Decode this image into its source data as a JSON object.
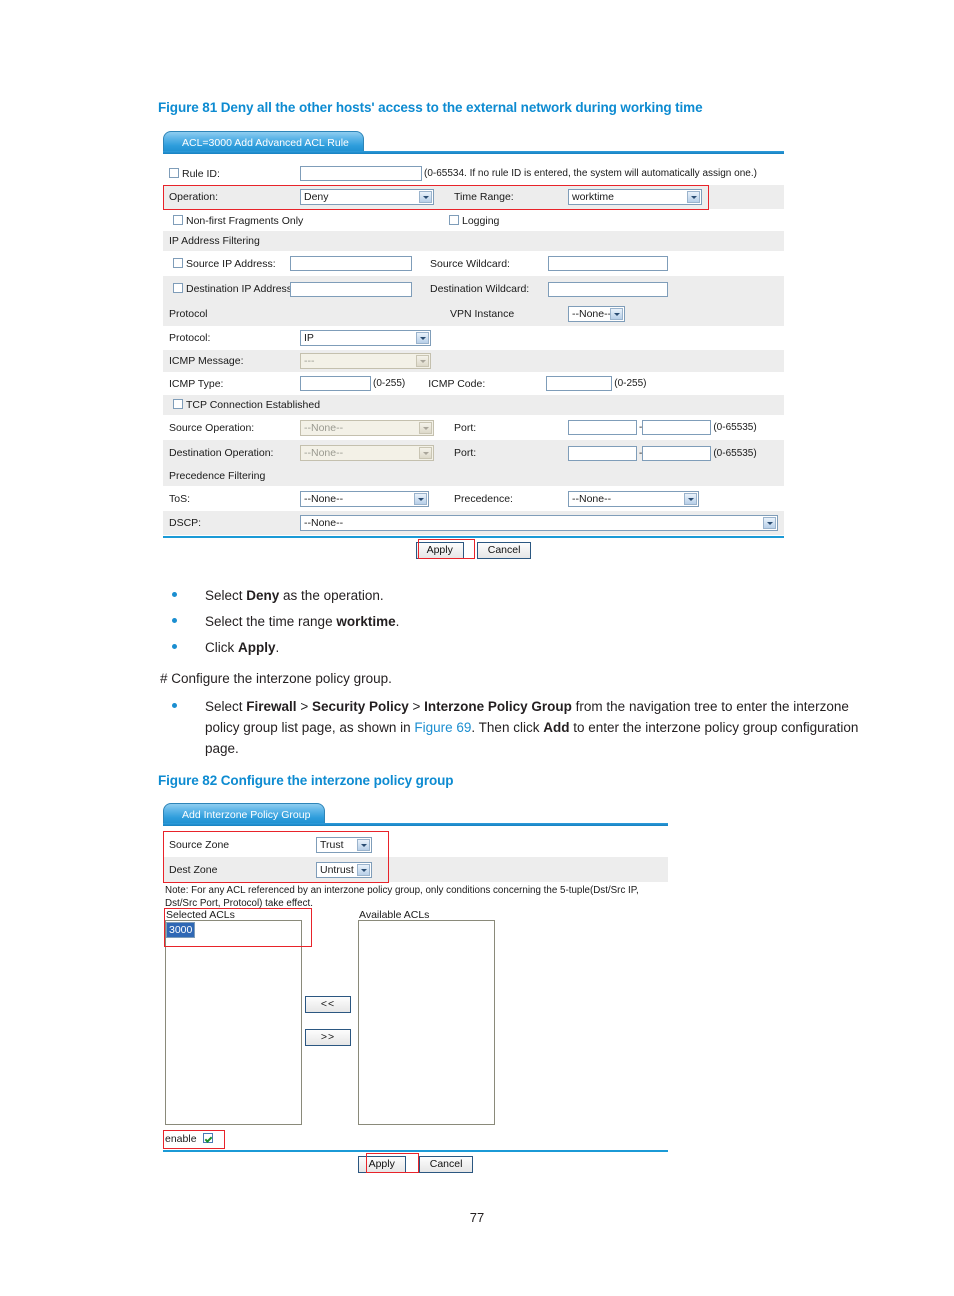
{
  "page": {
    "number": "77"
  },
  "figure81": {
    "caption": "Figure 81 Deny all the other hosts' access to the external network during working time",
    "tab_label": "ACL=3000 Add Advanced ACL Rule",
    "rows": {
      "rule_id_label": "Rule ID:",
      "rule_id_value": "",
      "rule_id_hint": "(0-65534. If no rule ID is entered, the system will automatically assign one.)",
      "operation_label": "Operation:",
      "operation_value": "Deny",
      "time_range_label": "Time Range:",
      "time_range_value": "worktime",
      "non_first_fragments_label": "Non-first Fragments Only",
      "logging_label": "Logging",
      "ip_address_filtering_header": "IP Address Filtering",
      "source_ip_label": "Source IP Address:",
      "source_ip_value": "",
      "source_wildcard_label": "Source Wildcard:",
      "source_wildcard_value": "",
      "dest_ip_label": "Destination IP Address:",
      "dest_ip_value": "",
      "dest_wildcard_label": "Destination Wildcard:",
      "dest_wildcard_value": "",
      "protocol_header": "Protocol",
      "vpn_instance_label": "VPN Instance",
      "vpn_instance_value": "--None--",
      "protocol_label": "Protocol:",
      "protocol_value": "IP",
      "icmp_message_label": "ICMP Message:",
      "icmp_message_value": "---",
      "icmp_type_label": "ICMP Type:",
      "icmp_type_value": "",
      "icmp_type_hint": "(0-255)",
      "icmp_code_label": "ICMP Code:",
      "icmp_code_value": "",
      "icmp_code_hint": "(0-255)",
      "tcp_conn_established_label": "TCP Connection Established",
      "source_operation_label": "Source Operation:",
      "source_operation_value": "--None--",
      "source_port_label": "Port:",
      "source_port_from": "",
      "source_port_to": "",
      "source_port_hint": "(0-65535)",
      "dest_operation_label": "Destination Operation:",
      "dest_operation_value": "--None--",
      "dest_port_label": "Port:",
      "dest_port_from": "",
      "dest_port_to": "",
      "dest_port_hint": "(0-65535)",
      "precedence_filtering_header": "Precedence Filtering",
      "tos_label": "ToS:",
      "tos_value": "--None--",
      "precedence_label": "Precedence:",
      "precedence_value": "--None--",
      "dscp_label": "DSCP:",
      "dscp_value": "--None--"
    },
    "buttons": {
      "apply": "Apply",
      "cancel": "Cancel"
    }
  },
  "steps": {
    "b1_pre": "Select ",
    "b1_bold": "Deny",
    "b1_post": " as the operation.",
    "b2_pre": "Select the time range ",
    "b2_bold": "worktime",
    "b2_post": ".",
    "b3_pre": "Click ",
    "b3_bold": "Apply",
    "b3_post": ".",
    "config_line": "# Configure the interzone policy group.",
    "b4_p1": "Select ",
    "b4_b1": "Firewall",
    "b4_p2": " > ",
    "b4_b2": "Security Policy",
    "b4_p3": " > ",
    "b4_b3": "Interzone Policy Group",
    "b4_p4": " from the navigation tree to enter the interzone policy group list page, as shown in ",
    "b4_link": "Figure 69",
    "b4_p5": ". Then click ",
    "b4_b4": "Add",
    "b4_p6": " to enter the interzone policy group configuration page."
  },
  "figure82": {
    "caption": "Figure 82 Configure the interzone policy group",
    "tab_label": "Add Interzone Policy Group",
    "source_zone_label": "Source Zone",
    "source_zone_value": "Trust",
    "dest_zone_label": "Dest Zone",
    "dest_zone_value": "Untrust",
    "note": "Note: For any ACL referenced by an interzone policy group, only conditions concerning the 5-tuple(Dst/Src IP, Dst/Src Port,  Protocol) take effect.",
    "selected_acls_label": "Selected ACLs",
    "selected_acls_items": [
      "3000"
    ],
    "available_acls_label": "Available ACLs",
    "available_acls_items": [],
    "move_left_label": "<<",
    "move_right_label": ">>",
    "enable_label": "enable",
    "buttons": {
      "apply": "Apply",
      "cancel": "Cancel"
    }
  },
  "colors": {
    "caption": "#0d8bd1",
    "annotation": "#e8232a",
    "tab_blue": "#2e9ddc",
    "bullet": "#1b8ed0",
    "selection": "#2f68b5"
  }
}
